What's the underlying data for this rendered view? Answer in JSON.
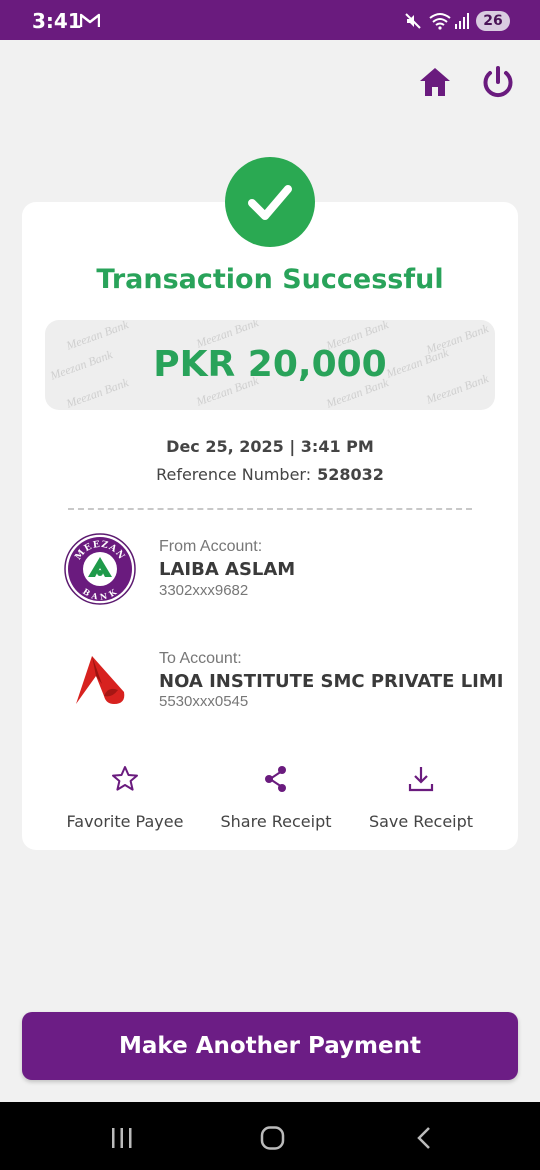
{
  "status_bar": {
    "time": "3:41",
    "battery": "26"
  },
  "header": {
    "home_icon": "home-icon",
    "power_icon": "power-icon"
  },
  "receipt": {
    "title": "Transaction Successful",
    "amount": "PKR 20,000",
    "watermark": "Meezan Bank",
    "date_time": "Dec 25, 2025 | 3:41 PM",
    "reference_label": "Reference Number:",
    "reference_number": "528032",
    "from": {
      "label": "From Account:",
      "name": "LAIBA ASLAM",
      "number": "3302xxx9682",
      "logo_text_top": "MEEZAN",
      "logo_text_bottom": "BANK"
    },
    "to": {
      "label": "To Account:",
      "name": "NOA INSTITUTE SMC PRIVATE LIMI",
      "number": "5530xxx0545"
    },
    "actions": [
      {
        "label": "Favorite Payee",
        "icon": "star-icon"
      },
      {
        "label": "Share Receipt",
        "icon": "share-icon"
      },
      {
        "label": "Save Receipt",
        "icon": "download-icon"
      }
    ]
  },
  "footer": {
    "primary_button": "Make Another Payment"
  },
  "colors": {
    "brand_purple": "#6a1b7e",
    "success_green": "#29a35a",
    "background": "#f1f1f1"
  }
}
